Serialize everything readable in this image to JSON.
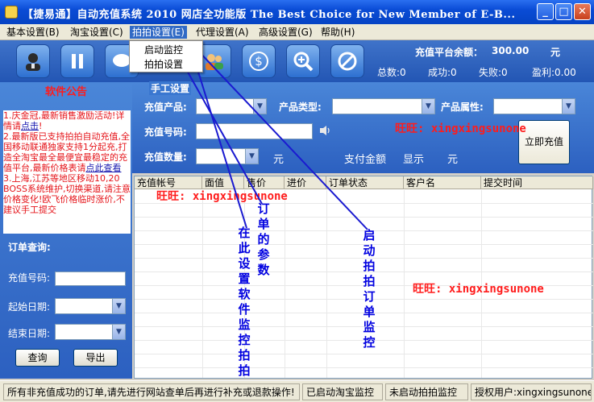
{
  "window": {
    "title": "【捷易通】自动充值系统 2010 网店全功能版  The Best Choice for New Member of E-B...",
    "minimize": "_",
    "maximize": "□",
    "close": "✕"
  },
  "menu": [
    {
      "label": "基本设置(B)"
    },
    {
      "label": "淘宝设置(C)"
    },
    {
      "label": "拍拍设置(E)"
    },
    {
      "label": "代理设置(A)"
    },
    {
      "label": "高级设置(G)"
    },
    {
      "label": "帮助(H)"
    }
  ],
  "dropdown": [
    "启动监控",
    "拍拍设置"
  ],
  "toolbar": {
    "icons": [
      "user-icon",
      "pause-icon",
      "chat-icon",
      "users-icon",
      "dollar-icon",
      "zoom-icon",
      "stop-icon"
    ],
    "balance_label": "充值平台余额：",
    "balance_value": "300.00",
    "balance_unit": "元",
    "stats": [
      {
        "label": "总数:",
        "value": "0"
      },
      {
        "label": "成功:",
        "value": "0"
      },
      {
        "label": "失败:",
        "value": "0"
      },
      {
        "label": "盈利:",
        "value": "0.00"
      }
    ]
  },
  "notice": {
    "title": "软件公告",
    "p1": "1.庆金冠,最新销售激励活动!详情请",
    "p1_link": "点击",
    "p1_end": "!",
    "p2": "2.最新版已支持拍拍自动充值,全国移动联通独家支持1分起充,打造全淘宝最全最便宜最稳定的充值平台,最新价格表请",
    "p2_link": "点此查看",
    "p3": "3.上海,江苏等地区移动10,20 BOSS系统维护,切换渠道,请注意价格变化!欧飞价格临时涨价,不建议手工提交"
  },
  "query": {
    "title": "订单查询:",
    "number_label": "充值号码:",
    "start_label": "起始日期:",
    "end_label": "结束日期:",
    "search_button": "查询",
    "export_button": "导出"
  },
  "manual": {
    "title": "手工设置",
    "product_label": "充值产品:",
    "type_label": "产品类型:",
    "attr_label": "产品属性:",
    "number_label": "充值号码:",
    "qty_label": "充值数量:",
    "qty_unit": "元",
    "pay_label": "支付金额",
    "pay_value": "显示",
    "pay_unit": "元",
    "recharge_button": "立即充值"
  },
  "table": {
    "columns": [
      "充值帐号",
      "面值",
      "售价",
      "进价",
      "订单状态",
      "客户名",
      "提交时间"
    ]
  },
  "status": {
    "message": "所有非充值成功的订单,请先进行网站查单后再进行补充或退款操作!",
    "taobao": "已启动淘宝监控",
    "paipai": "未启动拍拍监控",
    "user": "授权用户:xingxingsunone"
  },
  "overlay": {
    "wangwang": "旺旺: xingxingsunone",
    "note1": "在此设置软件监控拍拍",
    "note2": "订单的参数",
    "note3": "启动拍拍订单监控"
  }
}
